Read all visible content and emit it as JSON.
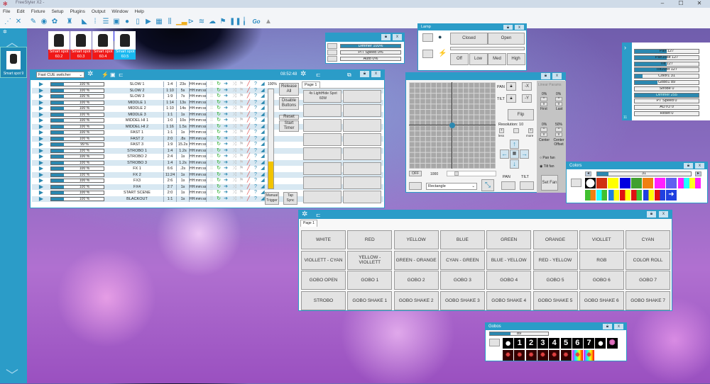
{
  "app": {
    "title": "FreeStyler X2 -",
    "controls": [
      "–",
      "☐",
      "✕"
    ]
  },
  "menu": [
    "File",
    "Edit",
    "Fixture",
    "Setup",
    "Plugins",
    "Output",
    "Window",
    "Help"
  ],
  "toolbar": [
    {
      "icon": "fixture-link-icon",
      "g": "⋰"
    },
    {
      "icon": "unlink-icon",
      "g": "✕"
    },
    {
      "icon": "pen-icon",
      "g": "✎"
    },
    {
      "icon": "gobo-wheel-icon",
      "g": "◉"
    },
    {
      "icon": "color-wheel-icon",
      "g": "✿"
    },
    {
      "icon": "moving-head-icon",
      "g": "♜"
    },
    {
      "icon": "ramp-icon",
      "g": "◣"
    },
    {
      "icon": "grid-icon",
      "g": "⁞"
    },
    {
      "icon": "list-icon",
      "g": "☰"
    },
    {
      "icon": "projector-icon",
      "g": "▣"
    },
    {
      "icon": "disc-icon",
      "g": "●"
    },
    {
      "icon": "new-document-icon",
      "g": "▯"
    },
    {
      "icon": "play-icon",
      "g": "▶"
    },
    {
      "icon": "matrix-icon",
      "g": "▦"
    },
    {
      "icon": "faders-icon",
      "g": "⫼"
    },
    {
      "icon": "bar-chart-icon",
      "g": "▁▃"
    },
    {
      "icon": "beam-icon",
      "g": "⊳"
    },
    {
      "icon": "dmx-in-icon",
      "g": "≋"
    },
    {
      "icon": "smoke-icon",
      "g": "☁"
    },
    {
      "icon": "flag-icon",
      "g": "⚑"
    },
    {
      "icon": "pause-icon",
      "g": "❚❚"
    },
    {
      "icon": "master-fader-icon",
      "g": "╽"
    },
    {
      "icon": "go-icon",
      "g": "Go"
    },
    {
      "icon": "warning-icon",
      "g": "▲"
    }
  ],
  "sidebar": {
    "selected_fixture": "Smart spot 9"
  },
  "fixtures": [
    {
      "label": "Smart spot 60.2",
      "color": "#f01818"
    },
    {
      "label": "Smart spot 60.3",
      "color": "#f01818"
    },
    {
      "label": "Smart spot 60.4",
      "color": "#f01818"
    },
    {
      "label": "Smart spot 60.5",
      "color": "#18b8f0"
    }
  ],
  "cue": {
    "mode": "Fast CUE switcher",
    "time": "08:52:48",
    "master": "100%",
    "master_level": 0.27,
    "rows": [
      {
        "pct": "100 %",
        "name": "SLOW 1",
        "ratio": "1:4",
        "time": "23s",
        "tc": "HH:mm:ss"
      },
      {
        "pct": "100 %",
        "name": "SLOW 2",
        "ratio": "1:10",
        "time": "5s",
        "tc": "HH:mm:ss"
      },
      {
        "pct": "100 %",
        "name": "SLOW 3",
        "ratio": "1:9",
        "time": "7s",
        "tc": "HH:mm:ss"
      },
      {
        "pct": "100 %",
        "name": "MIDDLE 1",
        "ratio": "1:14",
        "time": "13s",
        "tc": "HH:mm:ss"
      },
      {
        "pct": "100 %",
        "name": "MIDDLE 2",
        "ratio": "1:10",
        "time": "14s",
        "tc": "HH:mm:ss"
      },
      {
        "pct": "100 %",
        "name": "MIDDLE 3",
        "ratio": "1:1",
        "time": "1s",
        "tc": "HH:mm:ss"
      },
      {
        "pct": "100 %",
        "name": "MIDDEL HI 1",
        "ratio": "1:0",
        "time": "10s",
        "tc": "HH:mm:ss"
      },
      {
        "pct": "100 %",
        "name": "MIDDEL HI 2",
        "ratio": "1:16",
        "time": "1.5s",
        "tc": "HH:mm:ss"
      },
      {
        "pct": "100 %",
        "name": "FAST 1",
        "ratio": "1:1",
        "time": "1s",
        "tc": "HH:mm:ss"
      },
      {
        "pct": "100 %",
        "name": "FAST 2",
        "ratio": "2:0",
        "time": ".8s",
        "tc": "HH:mm:ss"
      },
      {
        "pct": "99 %",
        "name": "FAST 3",
        "ratio": "1:9",
        "time": "15.2s",
        "tc": "HH:mm:ss"
      },
      {
        "pct": "100 %",
        "name": "STROBO 1",
        "ratio": "1:4",
        "time": "1.2s",
        "tc": "HH:mm:ss"
      },
      {
        "pct": "100 %",
        "name": "STROBO 2",
        "ratio": "2:4",
        "time": "1s",
        "tc": "HH:mm:ss"
      },
      {
        "pct": "100 %",
        "name": "STROBO 3",
        "ratio": "1:4",
        "time": "1.2s",
        "tc": "HH:mm:ss"
      },
      {
        "pct": "100 %",
        "name": "FX 1",
        "ratio": "6:6",
        "time": ".2s",
        "tc": "HH:mm:ss"
      },
      {
        "pct": "100 %",
        "name": "FX 2",
        "ratio": "11:24",
        "time": "1s",
        "tc": "HH:mm:ss"
      },
      {
        "pct": "100 %",
        "name": "FX3",
        "ratio": "2:6",
        "time": "1s",
        "tc": "HH:mm:ss"
      },
      {
        "pct": "100 %",
        "name": "FX4",
        "ratio": "2:7",
        "time": "1s",
        "tc": "HH:mm:ss"
      },
      {
        "pct": "100 %",
        "name": "START SCENE",
        "ratio": "2:0",
        "time": "1s",
        "tc": "HH:mm:ss"
      },
      {
        "pct": "100 %",
        "name": "BLACKOUT",
        "ratio": "1:1",
        "time": "1s",
        "tc": "HH:mm:ss"
      }
    ],
    "buttons": {
      "release": "Release All",
      "disable": "Disable Buttons",
      "reset": "Reset",
      "start_timer": "Start Timer",
      "manual": "Manual Trigger",
      "tap": "Tap Sync"
    },
    "tab": "Page 1",
    "page_buttons": [
      "4x LightHide Spot 60W",
      "",
      "",
      "",
      "",
      "",
      "",
      "",
      "",
      "",
      "",
      "",
      "",
      "",
      "",
      ""
    ]
  },
  "dimmer": {
    "rows": [
      {
        "label": "Dimmer   100%",
        "v": 1
      },
      {
        "label": "P/T Speed    0%",
        "v": 0
      },
      {
        "label": "Auto    0%",
        "v": 0
      }
    ]
  },
  "lamp": {
    "title": "Lamp",
    "closed": "Closed",
    "open": "Open",
    "levels": [
      "Off",
      "Low",
      "Med",
      "High"
    ]
  },
  "pantilt": {
    "pan": "PAN",
    "tilt": "TILT",
    "invx": "-X",
    "invy": "-Y",
    "flip": "Flip",
    "resolution": "Resolution: 10",
    "less": "less",
    "more": "more",
    "off": "OFF",
    "speed": "1000",
    "shape": "Rectangle",
    "linear": "Linear Params",
    "first": "First",
    "last": "Last",
    "center": "Center",
    "center_offset": "Center Offset",
    "first_v": "0%",
    "last_v": "0%",
    "center_v": "0%",
    "offset_v": "50%",
    "pan_fan": "Pan fan",
    "tilt_fan": "Tilt fan",
    "set_fan": "Set Fan",
    "pan_pos": 0.5,
    "tilt_pos": 0.5
  },
  "channels": [
    {
      "n": "Pan",
      "v": "127",
      "f": 0.5
    },
    {
      "n": "Pan16bit",
      "v": "127",
      "f": 0.5
    },
    {
      "n": "Tilt",
      "v": "127",
      "f": 0.5
    },
    {
      "n": "Tilt16bit",
      "v": "127",
      "f": 0.5
    },
    {
      "n": "Color1",
      "v": "31",
      "f": 0.12
    },
    {
      "n": "Gobo1",
      "v": "89",
      "f": 0.35
    },
    {
      "n": "Strobe",
      "v": "0",
      "f": 0
    },
    {
      "n": "Dimmer",
      "v": "255",
      "f": 1
    },
    {
      "n": "PT Speed",
      "v": "0",
      "f": 0
    },
    {
      "n": "AUTO",
      "v": "0",
      "f": 0
    },
    {
      "n": "Reset",
      "v": "0",
      "f": 0
    }
  ],
  "channels_footer": "11",
  "colors": {
    "title": "Colors",
    "value": "31",
    "row1": [
      "#d03010",
      "#ffff00",
      "#0000e0",
      "#40a030",
      "#f08010",
      "#ff20ff",
      "#6060f0"
    ],
    "row2": [
      [
        "#40c030",
        "#f08010"
      ],
      [
        "#20ffff",
        "#40c030"
      ],
      [
        "#2080e0",
        "#ffff00"
      ],
      [
        "#e01010",
        "#ffff00"
      ],
      [
        "#e01010",
        "#40c030"
      ],
      [
        "#2040e0",
        "#ffff00"
      ],
      [
        "#e01010",
        "#2040e0"
      ]
    ]
  },
  "buttons_win": {
    "tab": "Page 1",
    "labels": [
      "WHITE",
      "RED",
      "YELLOW",
      "BLUE",
      "GREEN",
      "ORANGE",
      "VIOLLET",
      "CYAN",
      "VIOLLETT - CYAN",
      "YELLOW - VIOLLETT",
      "GREEN - ORANGE",
      "CYAN - GREEN",
      "BLUE - YELLOW",
      "RED - YELLOW",
      "RGB",
      "COLOR ROLL",
      "GOBO OPEN",
      "GOBO 1",
      "GOBO 2",
      "GOBO 3",
      "GOBO 4",
      "GOBO 5",
      "GOBO 6",
      "GOBO 7",
      "STROBO",
      "GOBO SHAKE 1",
      "GOBO SHAKE 2",
      "GOBO SHAKE 3",
      "GOBO SHAKE 4",
      "GOBO SHAKE 5",
      "GOBO SHAKE 6",
      "GOBO SHAKE 7"
    ]
  },
  "gobos": {
    "title": "Gobos",
    "value": "89",
    "row1": [
      "●",
      "1",
      "2",
      "3",
      "4",
      "5",
      "6",
      "7",
      "●",
      "✺"
    ],
    "row2": [
      "✹",
      "✹",
      "✹",
      "✹",
      "✹",
      "✹",
      "✹",
      "✹"
    ]
  },
  "colors_accent": {
    "blue": "#2b9cc8",
    "bar": "#2b88b0",
    "master": "#f2c400"
  }
}
